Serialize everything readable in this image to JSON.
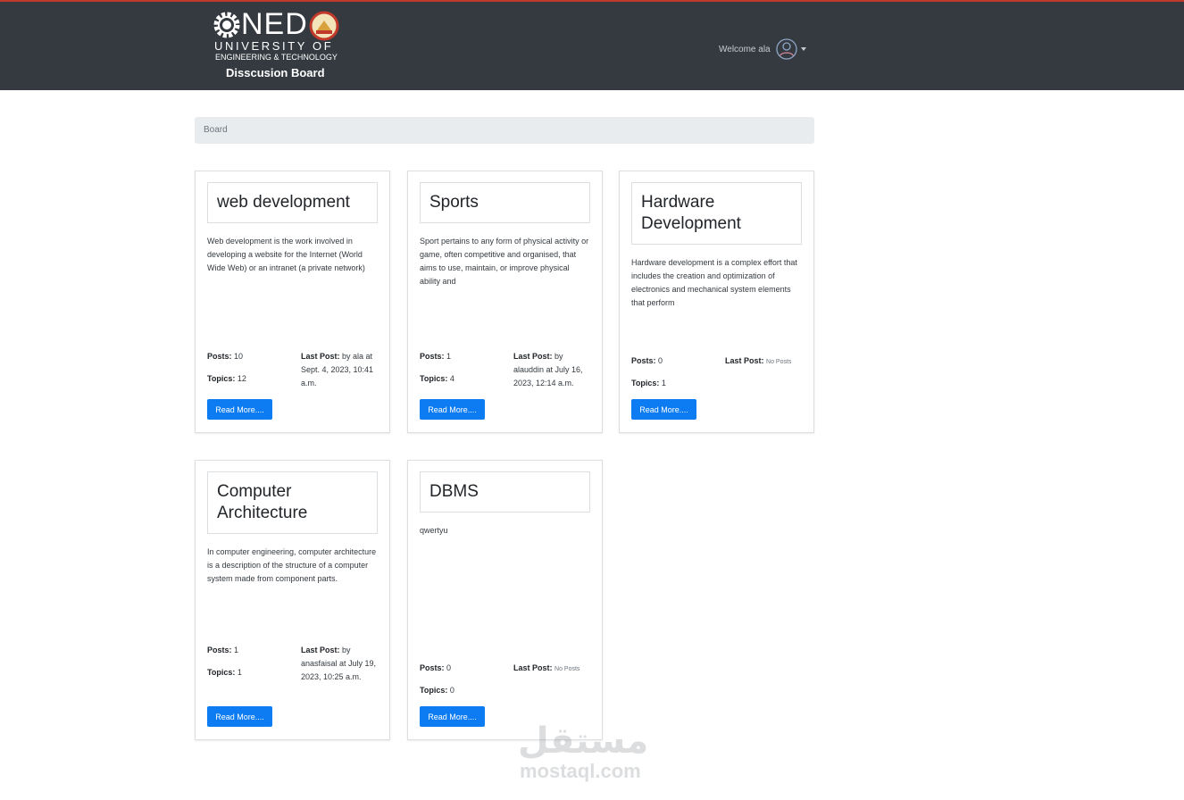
{
  "header": {
    "logo_word": "NED",
    "logo_university": "UNIVERSITY OF",
    "logo_engineering": "ENGINEERING & TECHNOLOGY",
    "brand_subtitle": "Disscusion Board",
    "welcome_text": "Welcome ala",
    "accent_color": "#c0392b"
  },
  "breadcrumb": {
    "label": "Board"
  },
  "labels": {
    "posts": "Posts:",
    "topics": "Topics:",
    "last_post": "Last Post:",
    "read_more": "Read More...."
  },
  "boards": [
    {
      "title": "web development",
      "description": "Web development is the work involved in developing a website for the Internet (World Wide Web) or an intranet (a private network)",
      "posts": "10",
      "topics": "12",
      "last_post": "by ala at Sept. 4, 2023, 10:41 a.m."
    },
    {
      "title": "Sports",
      "description": "Sport pertains to any form of physical activity or game, often competitive and organised, that aims to use, maintain, or improve physical ability and",
      "posts": "1",
      "topics": "4",
      "last_post": "by alauddin at July 16, 2023, 12:14 a.m."
    },
    {
      "title": "Hardware Development",
      "description": "Hardware development is a complex effort that includes the creation and optimization of electronics and mechanical system elements that perform",
      "posts": "0",
      "topics": "1",
      "last_post": "No Posts"
    },
    {
      "title": "Computer Architecture",
      "description": "In computer engineering, computer architecture is a description of the structure of a computer system made from component parts.",
      "posts": "1",
      "topics": "1",
      "last_post": "by anasfaisal at July 19, 2023, 10:25 a.m."
    },
    {
      "title": "DBMS",
      "description": "qwertyu",
      "posts": "0",
      "topics": "0",
      "last_post": "No Posts"
    }
  ],
  "watermark": {
    "arabic": "مستقل",
    "latin": "mostaql.com"
  },
  "colors": {
    "navbar": "#343a40",
    "button": "#0d7cf2",
    "breadcrumb_bg": "#e9ecef"
  }
}
